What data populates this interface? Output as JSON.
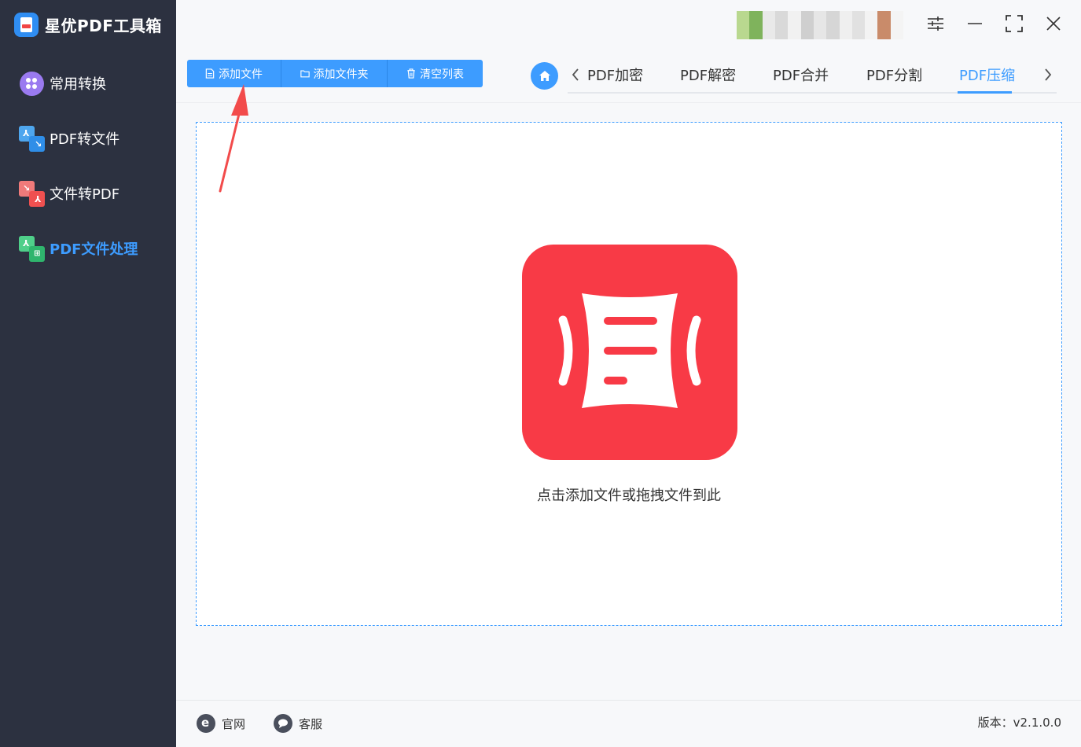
{
  "app": {
    "title": "星优PDF工具箱",
    "logo_icon": "pdf-app-logo-icon"
  },
  "sidebar": {
    "items": [
      {
        "label": "常用转换",
        "icon": "common-convert-icon",
        "active": false
      },
      {
        "label": "PDF转文件",
        "icon": "pdf-to-file-icon",
        "active": false
      },
      {
        "label": "文件转PDF",
        "icon": "file-to-pdf-icon",
        "active": false
      },
      {
        "label": "PDF文件处理",
        "icon": "pdf-process-icon",
        "active": true
      }
    ]
  },
  "window": {
    "controls": [
      "settings-icon",
      "minimize-icon",
      "maximize-icon",
      "close-icon"
    ]
  },
  "toolbar": {
    "add_file": "添加文件",
    "add_folder": "添加文件夹",
    "clear_list": "清空列表"
  },
  "tabs": {
    "items": [
      "PDF加密",
      "PDF解密",
      "PDF合并",
      "PDF分割",
      "PDF压缩"
    ],
    "active": "PDF压缩"
  },
  "dropzone": {
    "hint": "点击添加文件或拖拽文件到此",
    "icon": "compress-pdf-icon"
  },
  "footer": {
    "website": "官网",
    "support": "客服",
    "version": "版本：v2.1.0.0"
  },
  "colors": {
    "sidebar_bg": "#2c3140",
    "accent": "#3d9cff",
    "compress_red": "#f83a46",
    "annotation_red": "#f24b4b"
  }
}
